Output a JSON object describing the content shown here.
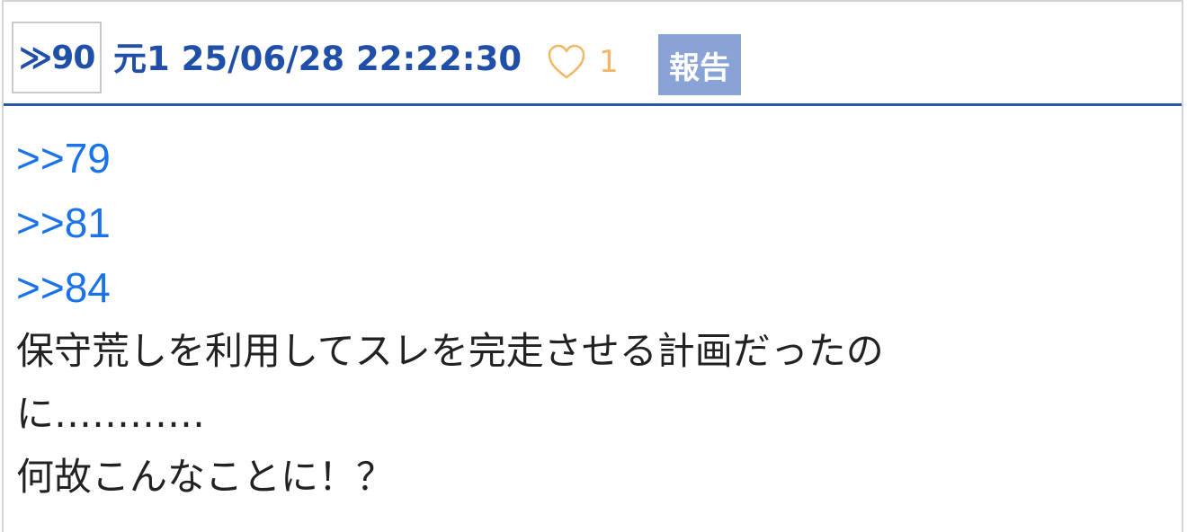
{
  "post": {
    "number_label": "≫90",
    "author": "元1",
    "timestamp": "25/06/28 22:22:30",
    "like_count": "1",
    "report_label": "報告",
    "like_color": "#f2b765",
    "accent_color": "#1f4fa8"
  },
  "body": {
    "anchors": [
      ">>79",
      ">>81",
      ">>84"
    ],
    "lines": [
      "保守荒しを利用してスレを完走させる計画だったの",
      "に…………",
      "何故こんなことに！？"
    ]
  },
  "icons": {
    "like": "heart-outline-icon"
  }
}
